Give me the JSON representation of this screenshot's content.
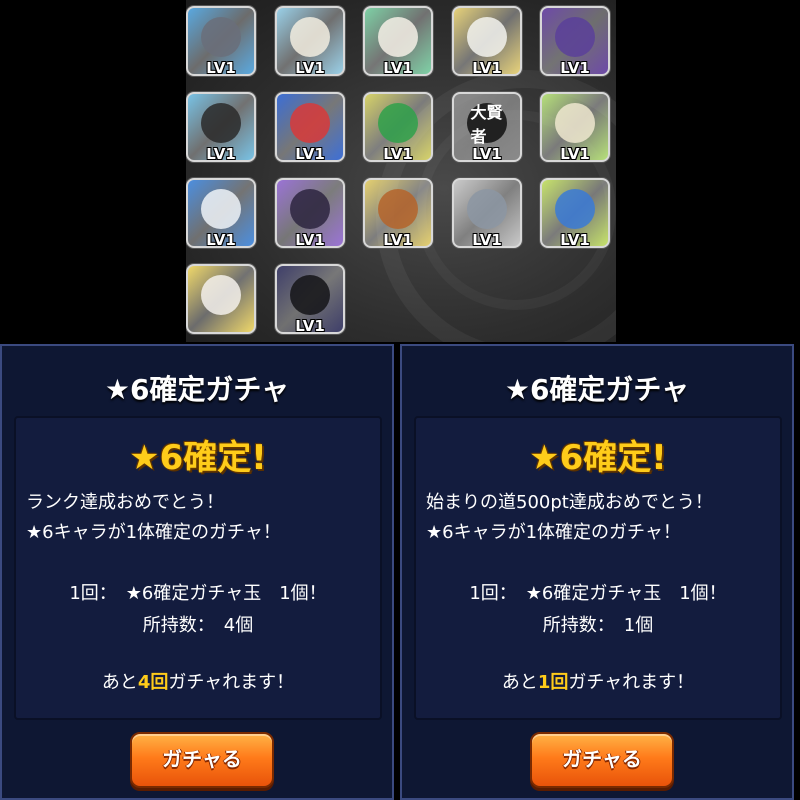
{
  "characters": [
    {
      "lv": "LV1",
      "bg": "#5aa9e0",
      "accent": "#6a6f7a",
      "icon": "beast-icon"
    },
    {
      "lv": "LV1",
      "bg": "#9ad0e8",
      "accent": "#f2ede0",
      "icon": "dog-icon"
    },
    {
      "lv": "LV1",
      "bg": "#7fd1a6",
      "accent": "#f5f0e6",
      "icon": "duck-icon"
    },
    {
      "lv": "LV1",
      "bg": "#e7d27a",
      "accent": "#f3f3ef",
      "icon": "doll-icon"
    },
    {
      "lv": "LV1",
      "bg": "#6e4aa8",
      "accent": "#5b3f9a",
      "icon": "villain-icon"
    },
    {
      "lv": "LV1",
      "bg": "#79c3e6",
      "accent": "#2a2a2a",
      "icon": "girl-icon"
    },
    {
      "lv": "LV1",
      "bg": "#3d6fd6",
      "accent": "#d83a3a",
      "icon": "shark-icon"
    },
    {
      "lv": "LV1",
      "bg": "#d7d36a",
      "accent": "#2fa14a",
      "icon": "frog-icon"
    },
    {
      "lv": "LV1",
      "bg": "#8a8a8a",
      "accent": "#111111",
      "icon": "great-sage-icon",
      "sign": "大賢者"
    },
    {
      "lv": "LV1",
      "bg": "#b6e07a",
      "accent": "#efe7cf",
      "icon": "elf-girl-icon"
    },
    {
      "lv": "LV1",
      "bg": "#4c8fe0",
      "accent": "#eef3f8",
      "icon": "panda-icon"
    },
    {
      "lv": "LV1",
      "bg": "#9b74d6",
      "accent": "#2d2540",
      "icon": "crow-icon"
    },
    {
      "lv": "LV1",
      "bg": "#e5d070",
      "accent": "#b5642a",
      "icon": "raccoon-icon"
    },
    {
      "lv": "LV1",
      "bg": "#c9c9c9",
      "accent": "#8c96a3",
      "icon": "robot-icon"
    },
    {
      "lv": "LV1",
      "bg": "#c7e36b",
      "accent": "#3a7ad6",
      "icon": "dragon-icon"
    },
    {
      "lv": "",
      "bg": "#f0d86a",
      "accent": "#f4f1ec",
      "icon": "fox-girl-icon"
    },
    {
      "lv": "LV1",
      "bg": "#3f3f6a",
      "accent": "#141418",
      "icon": "fluffball-icon"
    }
  ],
  "panel_left": {
    "title": "★6確定ガチャ",
    "confirm": "★6確定!",
    "desc_line1": "ランク達成おめでとう！",
    "desc_line2": "★6キャラが1体確定のガチャ！",
    "cost_line1": "1回：　★6確定ガチャ玉　1個！",
    "cost_line2": "所持数：　4個",
    "remain_prefix": "あと",
    "remain_count": "4回",
    "remain_suffix": "ガチャれます！",
    "button": "ガチャる"
  },
  "panel_right": {
    "title": "★6確定ガチャ",
    "confirm": "★6確定!",
    "desc_line1": "始まりの道500pt達成おめでとう！",
    "desc_line2": "★6キャラが1体確定のガチャ！",
    "cost_line1": "1回：　★6確定ガチャ玉　1個！",
    "cost_line2": "所持数：　1個",
    "remain_prefix": "あと",
    "remain_count": "1回",
    "remain_suffix": "ガチャれます！",
    "button": "ガチャる"
  },
  "colors": {
    "highlight": "#ffcc1a",
    "panel_bg": "#0e1733",
    "button": "#ff7b1a"
  }
}
